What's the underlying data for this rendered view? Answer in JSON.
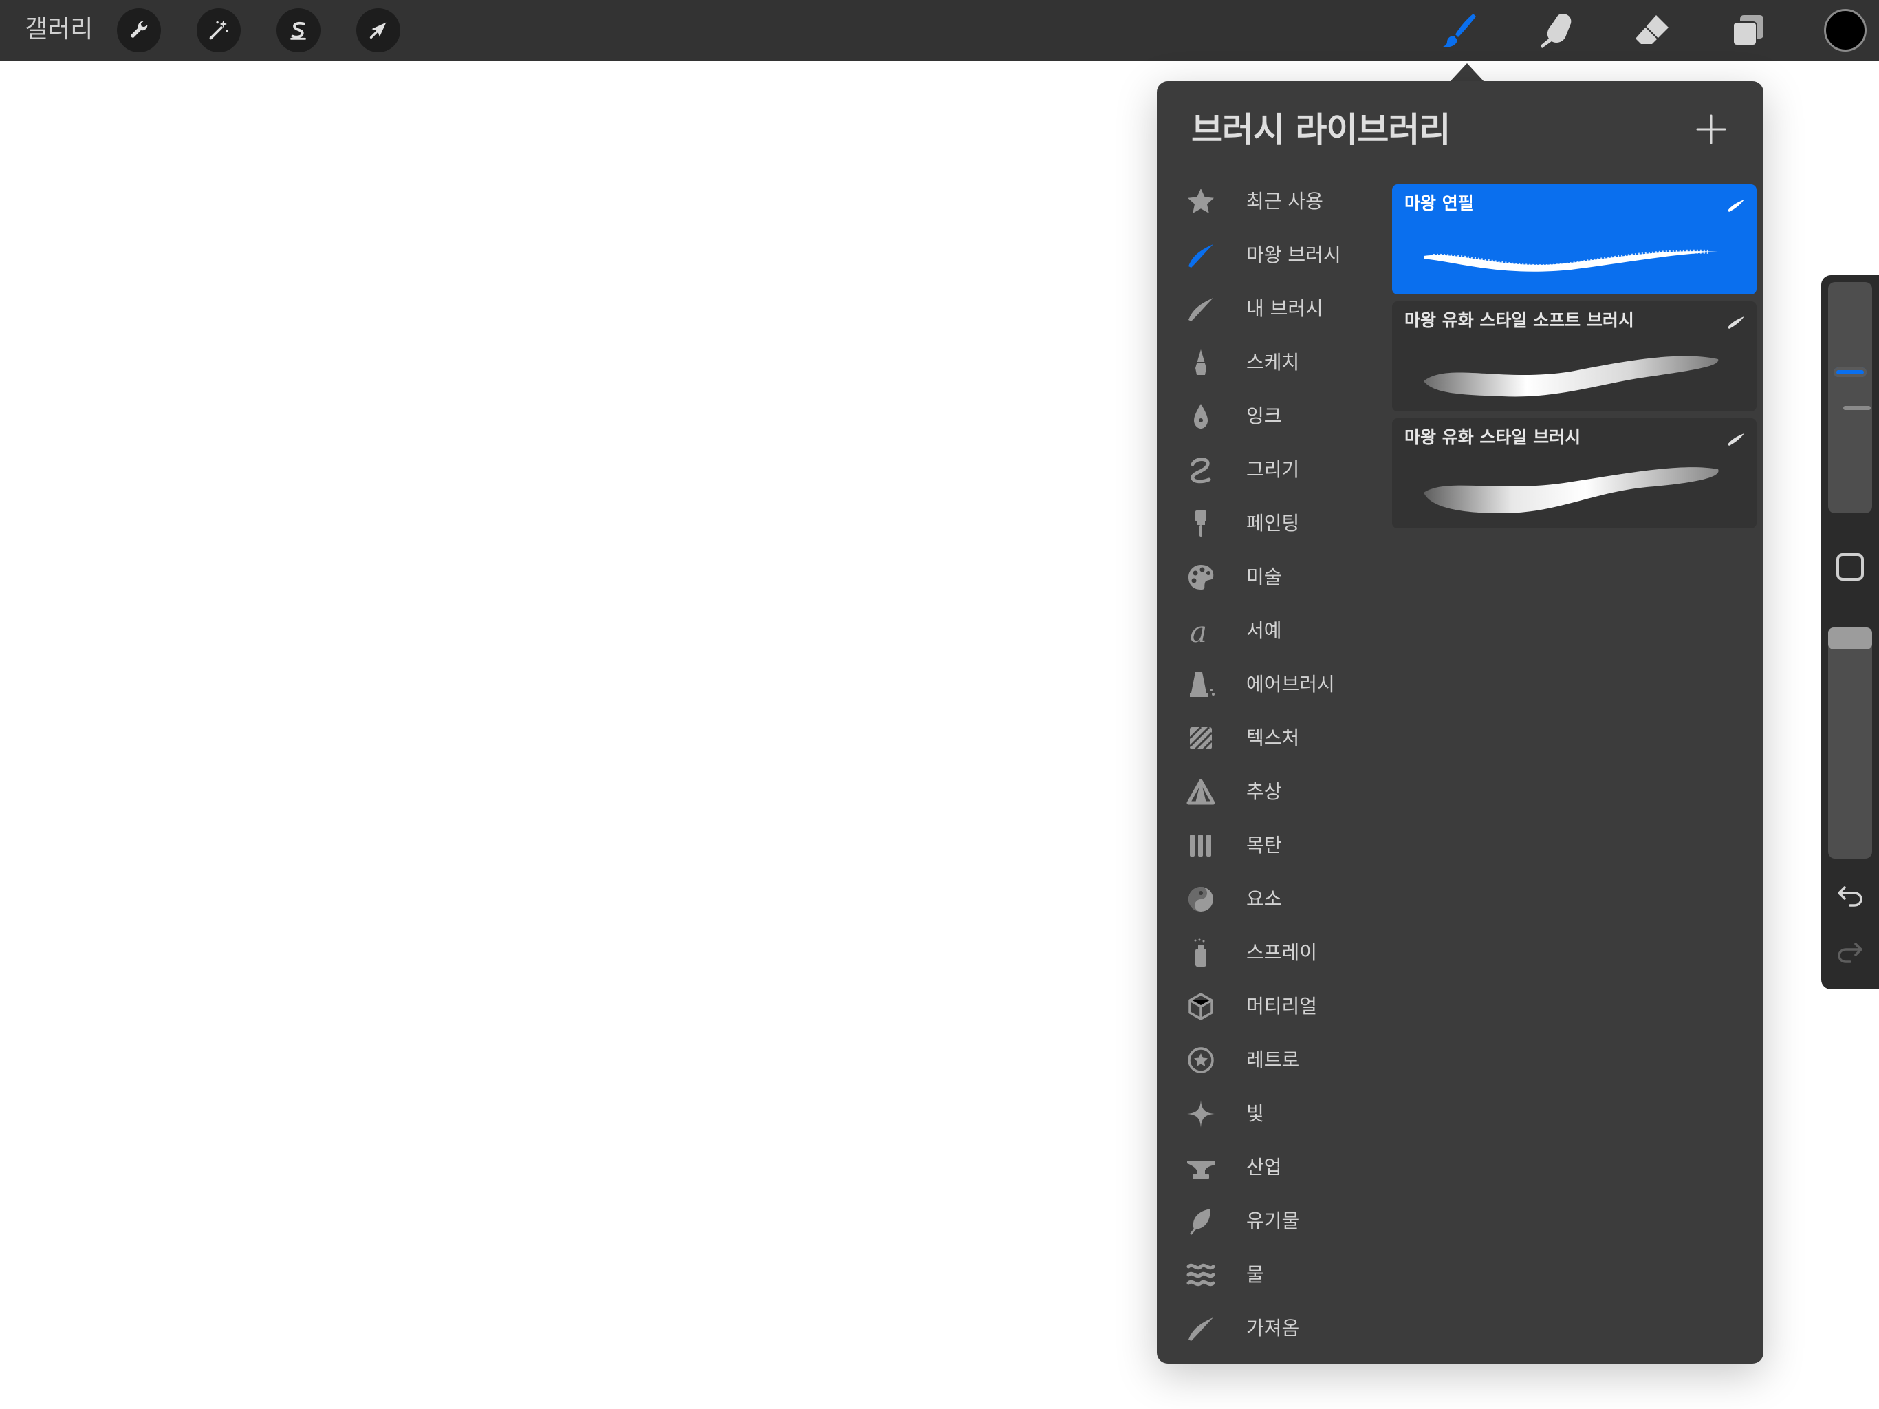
{
  "topbar": {
    "gallery_label": "갤러리",
    "actions": [
      {
        "name": "actions-button",
        "icon": "wrench-icon"
      },
      {
        "name": "adjustments-button",
        "icon": "magic-wand-icon"
      },
      {
        "name": "selection-button",
        "icon": "selection-s-icon"
      },
      {
        "name": "transform-button",
        "icon": "arrow-cursor-icon"
      }
    ],
    "tools": [
      {
        "name": "brush-tool-button",
        "icon": "brush-icon",
        "active": true
      },
      {
        "name": "smudge-tool-button",
        "icon": "smudge-finger-icon",
        "active": false
      },
      {
        "name": "eraser-tool-button",
        "icon": "eraser-icon",
        "active": false
      },
      {
        "name": "layers-button",
        "icon": "layers-icon",
        "active": false
      }
    ],
    "current_color": "#000000"
  },
  "brush_library": {
    "title": "브러시 라이브러리",
    "add_icon": "plus-icon",
    "categories": [
      {
        "label": "최근 사용",
        "icon": "star-icon",
        "active": false
      },
      {
        "label": "마왕 브러시",
        "icon": "brush-stroke-icon",
        "active": true
      },
      {
        "label": "내 브러시",
        "icon": "brush-stroke-icon",
        "active": false
      },
      {
        "label": "스케치",
        "icon": "pencil-tip-icon",
        "active": false
      },
      {
        "label": "잉크",
        "icon": "ink-drop-icon",
        "active": false
      },
      {
        "label": "그리기",
        "icon": "squiggle-icon",
        "active": false
      },
      {
        "label": "페인팅",
        "icon": "paint-brush-icon",
        "active": false
      },
      {
        "label": "미술",
        "icon": "palette-icon",
        "active": false
      },
      {
        "label": "서예",
        "icon": "calligraphy-a-icon",
        "active": false
      },
      {
        "label": "에어브러시",
        "icon": "airbrush-icon",
        "active": false
      },
      {
        "label": "텍스처",
        "icon": "texture-icon",
        "active": false
      },
      {
        "label": "추상",
        "icon": "triangle-icon",
        "active": false
      },
      {
        "label": "목탄",
        "icon": "charcoal-sticks-icon",
        "active": false
      },
      {
        "label": "요소",
        "icon": "yin-yang-icon",
        "active": false
      },
      {
        "label": "스프레이",
        "icon": "spray-can-icon",
        "active": false
      },
      {
        "label": "머티리얼",
        "icon": "cube-icon",
        "active": false
      },
      {
        "label": "레트로",
        "icon": "retro-star-icon",
        "active": false
      },
      {
        "label": "빛",
        "icon": "sparkle-icon",
        "active": false
      },
      {
        "label": "산업",
        "icon": "anvil-icon",
        "active": false
      },
      {
        "label": "유기물",
        "icon": "leaf-icon",
        "active": false
      },
      {
        "label": "물",
        "icon": "waves-icon",
        "active": false
      },
      {
        "label": "가져옴",
        "icon": "brush-stroke-icon",
        "active": false
      }
    ],
    "brushes": [
      {
        "name": "마왕 연필",
        "selected": true
      },
      {
        "name": "마왕 유화 스타일 소프트 브러시",
        "selected": false
      },
      {
        "name": "마왕 유화 스타일 브러시",
        "selected": false
      }
    ]
  },
  "sidebar": {
    "size_level": 0.63,
    "opacity_level": 1.0,
    "modify_icon": "square-icon",
    "undo_icon": "undo-arrow-icon",
    "redo_icon": "redo-arrow-icon"
  },
  "colors": {
    "accent": "#0a6fee",
    "panel": "#3c3c3c",
    "toolbar": "#333333"
  }
}
